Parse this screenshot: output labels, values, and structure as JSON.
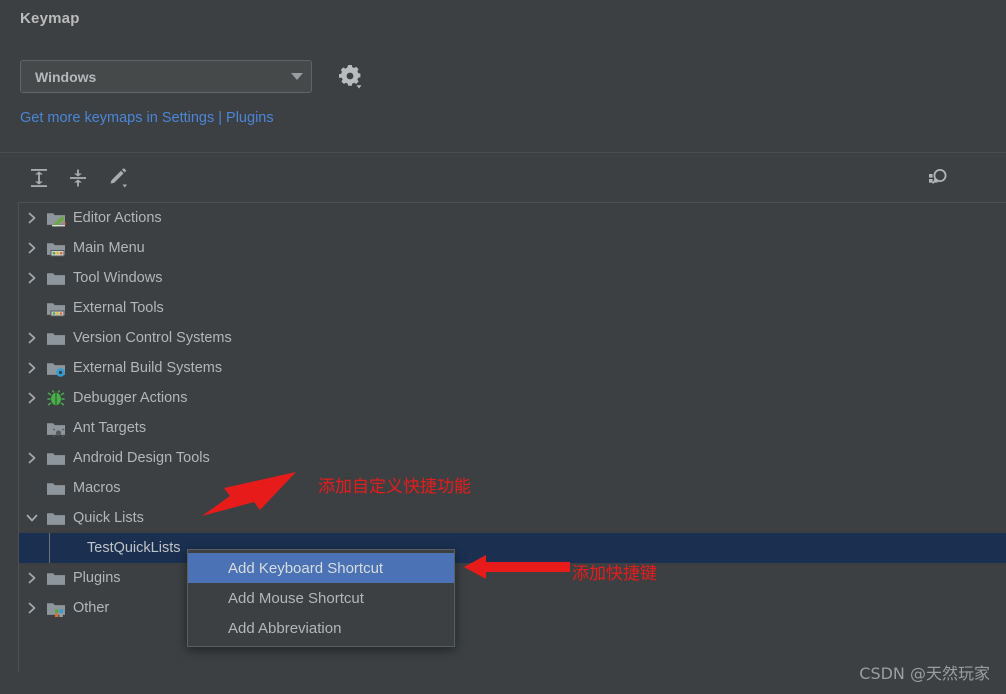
{
  "header": {
    "title": "Keymap",
    "keymap_select": {
      "value": "Windows",
      "icon": "chevron-down-icon"
    },
    "gear": {
      "icon": "gear-icon"
    },
    "link": "Get more keymaps in Settings | Plugins"
  },
  "toolbar": {
    "buttons": [
      {
        "name": "expand-all-button",
        "icon": "expand-all-icon"
      },
      {
        "name": "collapse-all-button",
        "icon": "collapse-all-icon"
      },
      {
        "name": "edit-shortcut-button",
        "icon": "pencil-icon"
      }
    ],
    "search": {
      "value": "",
      "placeholder": "",
      "icon": "search-icon"
    },
    "find_by_shortcut": {
      "icon": "find-by-shortcut-icon"
    }
  },
  "tree": {
    "items": [
      {
        "label": "Editor Actions",
        "expandable": true,
        "expanded": false,
        "icon": "folder-editor-icon",
        "indent": 0
      },
      {
        "label": "Main Menu",
        "expandable": true,
        "expanded": false,
        "icon": "folder-menu-icon",
        "indent": 0
      },
      {
        "label": "Tool Windows",
        "expandable": true,
        "expanded": false,
        "icon": "folder-plain-icon",
        "indent": 0
      },
      {
        "label": "External Tools",
        "expandable": false,
        "expanded": false,
        "icon": "folder-tools-icon",
        "indent": 0
      },
      {
        "label": "Version Control Systems",
        "expandable": true,
        "expanded": false,
        "icon": "folder-plain-icon",
        "indent": 0
      },
      {
        "label": "External Build Systems",
        "expandable": true,
        "expanded": false,
        "icon": "folder-gear-icon",
        "indent": 0
      },
      {
        "label": "Debugger Actions",
        "expandable": true,
        "expanded": false,
        "icon": "bug-icon",
        "indent": 0
      },
      {
        "label": "Ant Targets",
        "expandable": false,
        "expanded": false,
        "icon": "folder-ant-icon",
        "indent": 0
      },
      {
        "label": "Android Design Tools",
        "expandable": true,
        "expanded": false,
        "icon": "folder-plain-icon",
        "indent": 0
      },
      {
        "label": "Macros",
        "expandable": false,
        "expanded": false,
        "icon": "folder-plain-icon",
        "indent": 0
      },
      {
        "label": "Quick Lists",
        "expandable": true,
        "expanded": true,
        "icon": "folder-plain-icon",
        "indent": 0
      },
      {
        "label": "TestQuickLists",
        "expandable": false,
        "expanded": false,
        "icon": "none",
        "indent": 1,
        "selected": true
      },
      {
        "label": "Plugins",
        "expandable": true,
        "expanded": false,
        "icon": "folder-plain-icon",
        "indent": 0
      },
      {
        "label": "Other",
        "expandable": true,
        "expanded": false,
        "icon": "folder-other-icon",
        "indent": 0
      }
    ]
  },
  "context_menu": {
    "items": [
      {
        "label": "Add Keyboard Shortcut",
        "active": true
      },
      {
        "label": "Add Mouse Shortcut",
        "active": false
      },
      {
        "label": "Add Abbreviation",
        "active": false
      }
    ]
  },
  "annotations": [
    {
      "text": "添加自定义快捷功能",
      "arrow": "diagonal-down-left-arrow"
    },
    {
      "text": "添加快捷键",
      "arrow": "left-arrow"
    }
  ],
  "watermark": "CSDN @天然玩家",
  "colors": {
    "background": "#3c4043",
    "panel": "#45494a",
    "border": "#5e6363",
    "text": "#b2b6b8",
    "link": "#4a86d8",
    "selection_row": "#1b3050",
    "menu_highlight": "#4a72b5",
    "annotation": "#e81b1b"
  }
}
